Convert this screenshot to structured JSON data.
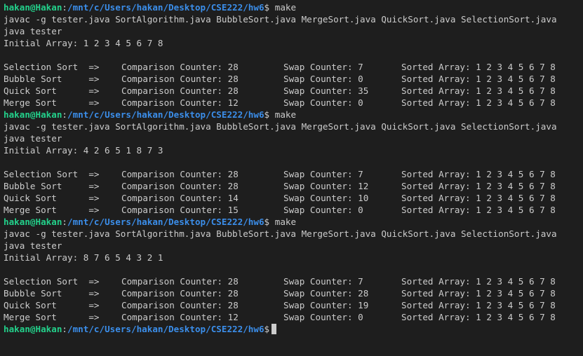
{
  "prompt": {
    "user": "hakan@Hakan",
    "sep": ":",
    "path": "/mnt/c/Users/hakan/Desktop/CSE222/hw6",
    "symbol": "$"
  },
  "runs": [
    {
      "command": "make",
      "compile": "javac -g tester.java SortAlgorithm.java BubbleSort.java MergeSort.java QuickSort.java SelectionSort.java",
      "run": "java tester",
      "initial": "Initial Array: 1 2 3 4 5 6 7 8",
      "rows": [
        {
          "name": "Selection Sort  =>",
          "comp": "Comparison Counter: 28",
          "swap": "Swap Counter: 7",
          "sorted": "Sorted Array: 1 2 3 4 5 6 7 8"
        },
        {
          "name": "Bubble Sort     =>",
          "comp": "Comparison Counter: 28",
          "swap": "Swap Counter: 0",
          "sorted": "Sorted Array: 1 2 3 4 5 6 7 8"
        },
        {
          "name": "Quick Sort      =>",
          "comp": "Comparison Counter: 28",
          "swap": "Swap Counter: 35",
          "sorted": "Sorted Array: 1 2 3 4 5 6 7 8"
        },
        {
          "name": "Merge Sort      =>",
          "comp": "Comparison Counter: 12",
          "swap": "Swap Counter: 0",
          "sorted": "Sorted Array: 1 2 3 4 5 6 7 8"
        }
      ]
    },
    {
      "command": "make",
      "compile": "javac -g tester.java SortAlgorithm.java BubbleSort.java MergeSort.java QuickSort.java SelectionSort.java",
      "run": "java tester",
      "initial": "Initial Array: 4 2 6 5 1 8 7 3",
      "rows": [
        {
          "name": "Selection Sort  =>",
          "comp": "Comparison Counter: 28",
          "swap": "Swap Counter: 7",
          "sorted": "Sorted Array: 1 2 3 4 5 6 7 8"
        },
        {
          "name": "Bubble Sort     =>",
          "comp": "Comparison Counter: 28",
          "swap": "Swap Counter: 12",
          "sorted": "Sorted Array: 1 2 3 4 5 6 7 8"
        },
        {
          "name": "Quick Sort      =>",
          "comp": "Comparison Counter: 14",
          "swap": "Swap Counter: 10",
          "sorted": "Sorted Array: 1 2 3 4 5 6 7 8"
        },
        {
          "name": "Merge Sort      =>",
          "comp": "Comparison Counter: 15",
          "swap": "Swap Counter: 0",
          "sorted": "Sorted Array: 1 2 3 4 5 6 7 8"
        }
      ]
    },
    {
      "command": "make",
      "compile": "javac -g tester.java SortAlgorithm.java BubbleSort.java MergeSort.java QuickSort.java SelectionSort.java",
      "run": "java tester",
      "initial": "Initial Array: 8 7 6 5 4 3 2 1",
      "rows": [
        {
          "name": "Selection Sort  =>",
          "comp": "Comparison Counter: 28",
          "swap": "Swap Counter: 7",
          "sorted": "Sorted Array: 1 2 3 4 5 6 7 8"
        },
        {
          "name": "Bubble Sort     =>",
          "comp": "Comparison Counter: 28",
          "swap": "Swap Counter: 28",
          "sorted": "Sorted Array: 1 2 3 4 5 6 7 8"
        },
        {
          "name": "Quick Sort      =>",
          "comp": "Comparison Counter: 28",
          "swap": "Swap Counter: 19",
          "sorted": "Sorted Array: 1 2 3 4 5 6 7 8"
        },
        {
          "name": "Merge Sort      =>",
          "comp": "Comparison Counter: 12",
          "swap": "Swap Counter: 0",
          "sorted": "Sorted Array: 1 2 3 4 5 6 7 8"
        }
      ]
    }
  ],
  "colors": {
    "background": "#1e1e1e",
    "text": "#cccccc",
    "prompt_user": "#23d18b",
    "prompt_path": "#3b8eea"
  }
}
